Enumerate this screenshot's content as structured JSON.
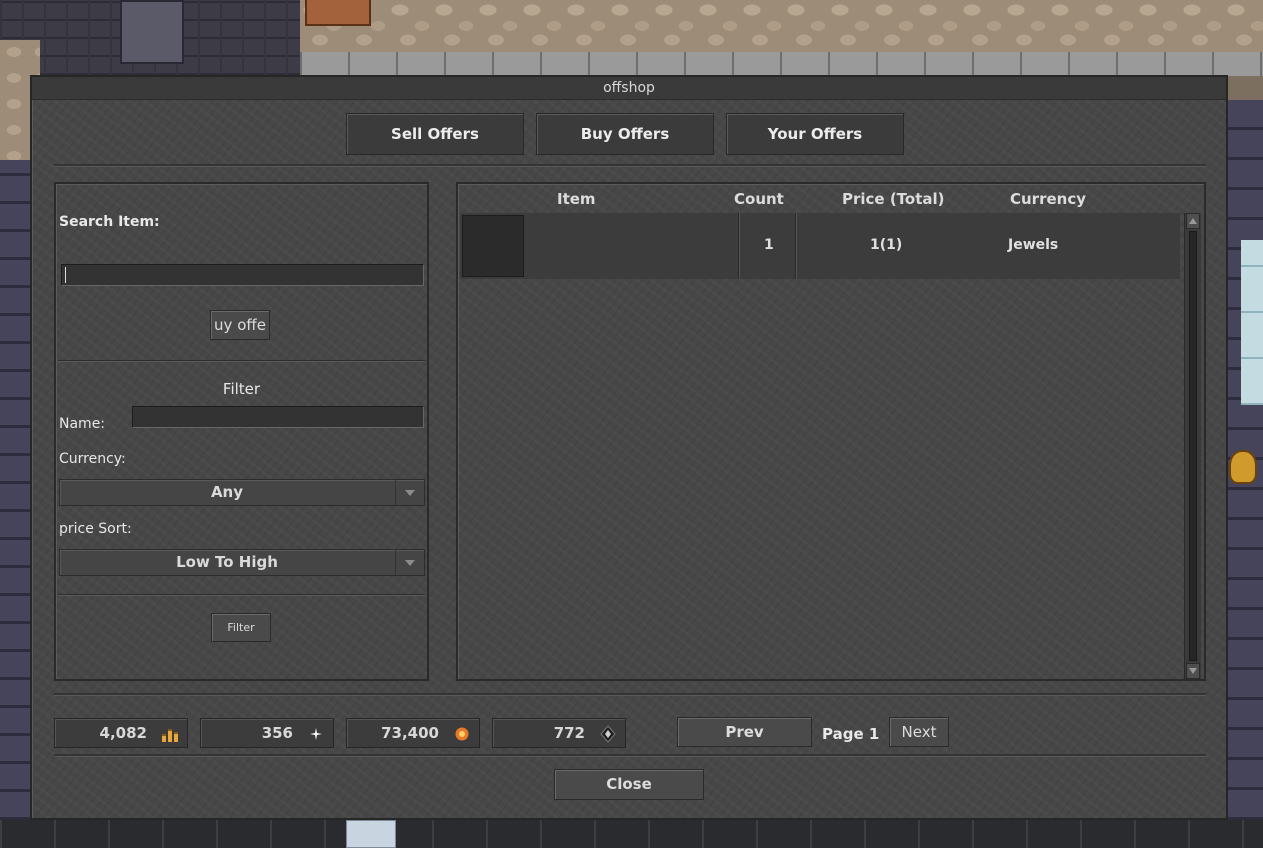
{
  "window": {
    "title": "offshop"
  },
  "tabs": [
    {
      "label": "Sell Offers"
    },
    {
      "label": "Buy Offers"
    },
    {
      "label": "Your Offers"
    }
  ],
  "search": {
    "label": "Search Item:",
    "value": "",
    "button_label": "uy offe"
  },
  "filter": {
    "title": "Filter",
    "name_label": "Name:",
    "name_value": "",
    "currency_label": "Currency:",
    "currency_value": "Any",
    "sort_label": "price Sort:",
    "sort_value": "Low To High",
    "button_label": "Filter"
  },
  "offers": {
    "columns": [
      "Item",
      "Count",
      "Price (Total)",
      "Currency"
    ],
    "rows": [
      {
        "count": "1",
        "price": "1(1)",
        "currency": "Jewels"
      }
    ]
  },
  "balances": [
    {
      "amount": "4,082",
      "icon": "gold-coins-icon",
      "color": "#e8a53a"
    },
    {
      "amount": "356",
      "icon": "sparkle-icon",
      "color": "#ffffff"
    },
    {
      "amount": "73,400",
      "icon": "orange-coin-icon",
      "color": "#e67a2a"
    },
    {
      "amount": "772",
      "icon": "dark-gem-icon",
      "color": "#1e1e1e"
    }
  ],
  "pagination": {
    "prev_label": "Prev",
    "page_label": "Page 1",
    "next_label": "Next"
  },
  "close_label": "Close"
}
